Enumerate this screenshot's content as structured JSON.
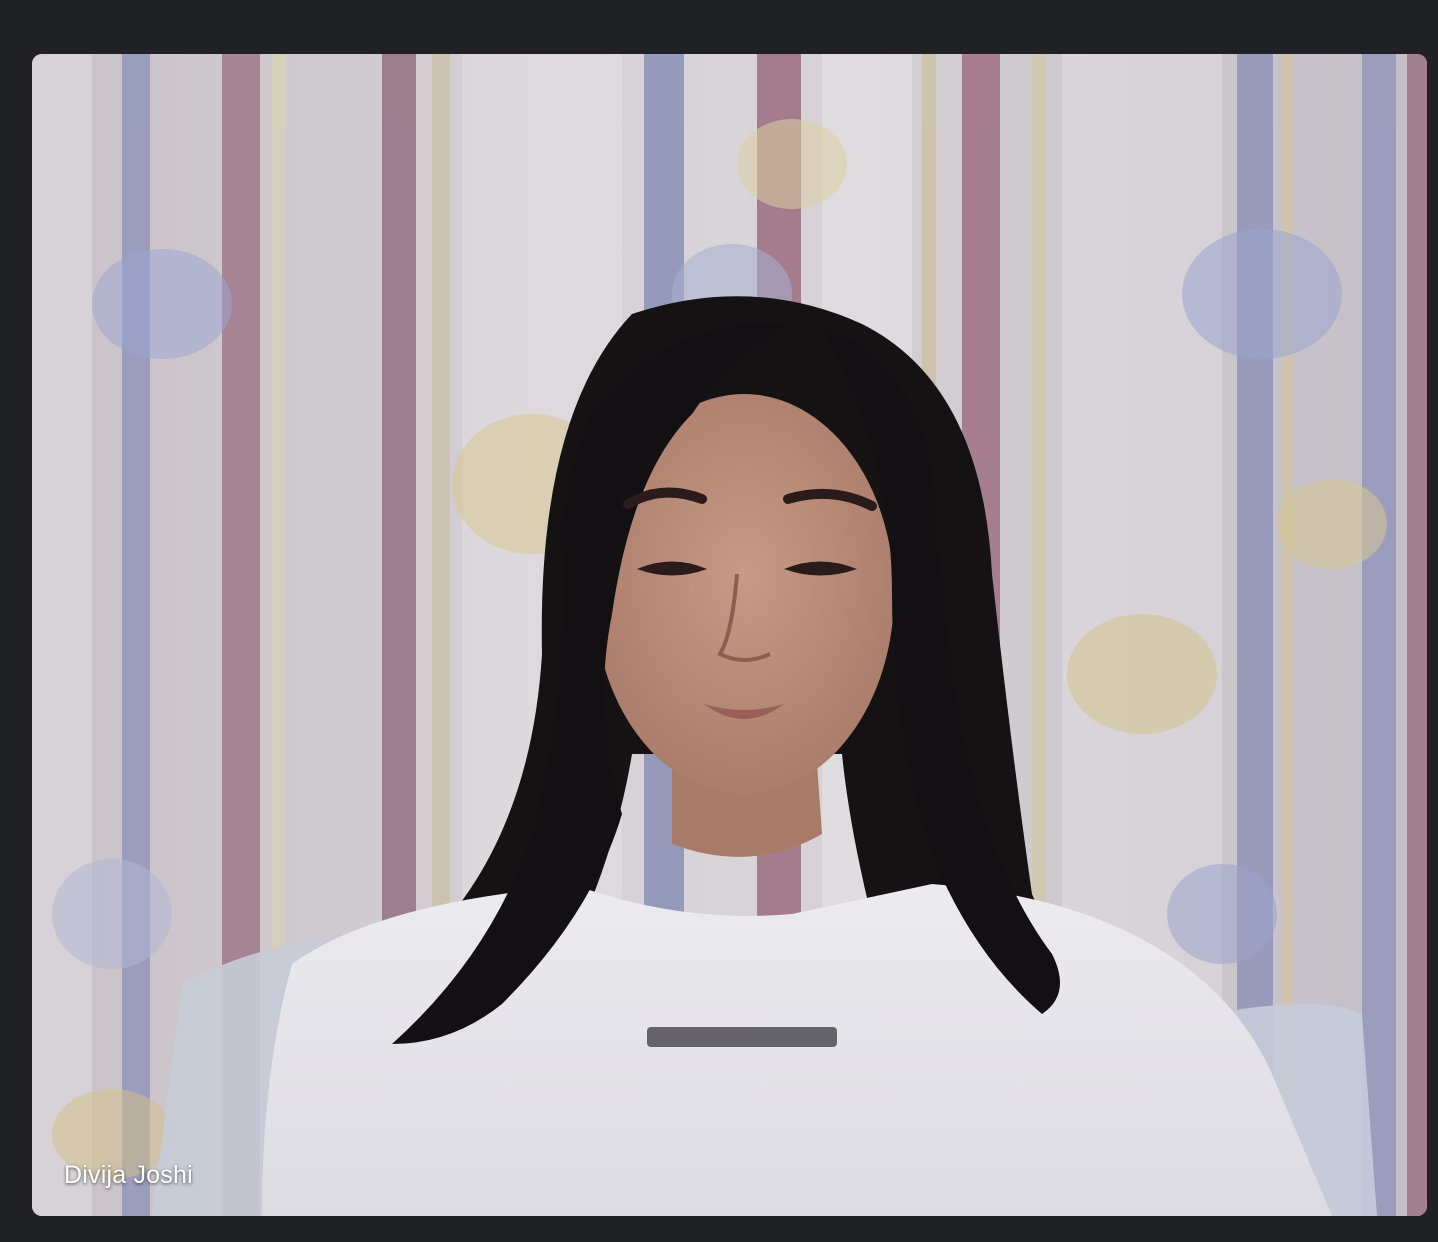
{
  "participant": {
    "name": "Divija Joshi",
    "camera_on": true
  },
  "colors": {
    "app_background": "#202124",
    "name_label": "#ffffff"
  },
  "icons": []
}
